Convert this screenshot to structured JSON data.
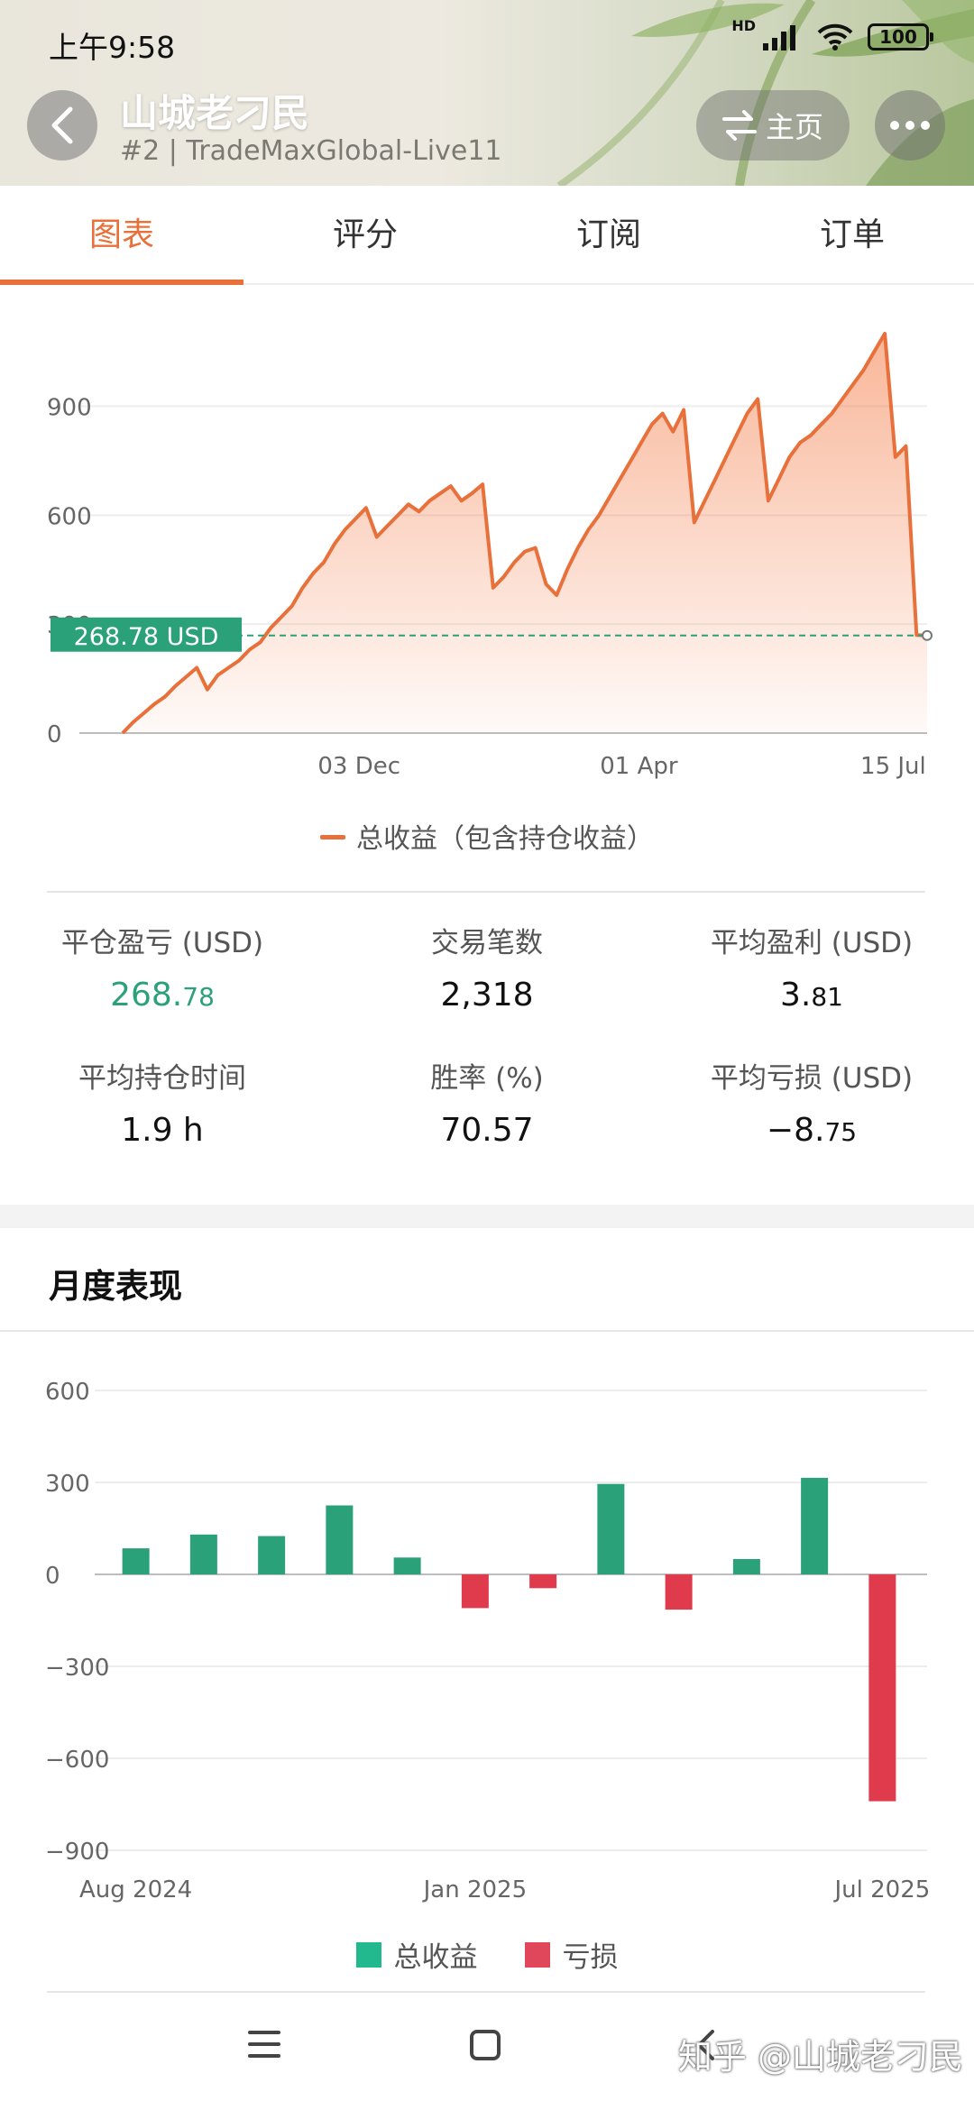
{
  "status": {
    "time": "上午9:58",
    "hd": "HD",
    "battery": "100"
  },
  "header": {
    "title": "山城老刁民",
    "subtitle": "#2 | TradeMaxGlobal-Live11",
    "home_label": "主页"
  },
  "tabs": [
    {
      "label": "图表",
      "active": true
    },
    {
      "label": "评分",
      "active": false
    },
    {
      "label": "订阅",
      "active": false
    },
    {
      "label": "订单",
      "active": false
    }
  ],
  "chart_data": [
    {
      "type": "area",
      "y_ticks": [
        "0",
        "300",
        "600",
        "900"
      ],
      "ylim": [
        0,
        1100
      ],
      "x_tick_labels": [
        "03 Dec",
        "01 Apr",
        "15 Jul"
      ],
      "x_tick_positions": [
        0.33,
        0.66,
        0.96
      ],
      "series": [
        {
          "name": "总收益（包含持仓收益）",
          "color": "#e8703a",
          "values": [
            0,
            30,
            55,
            80,
            100,
            130,
            155,
            180,
            120,
            160,
            180,
            200,
            230,
            250,
            290,
            320,
            350,
            400,
            440,
            470,
            520,
            560,
            590,
            620,
            540,
            570,
            600,
            630,
            610,
            640,
            660,
            680,
            640,
            660,
            685,
            400,
            430,
            470,
            500,
            510,
            410,
            380,
            450,
            510,
            560,
            600,
            650,
            700,
            750,
            800,
            850,
            880,
            830,
            890,
            580,
            640,
            700,
            760,
            820,
            880,
            920,
            640,
            700,
            760,
            800,
            820,
            850,
            880,
            920,
            960,
            1000,
            1050,
            1100,
            760,
            790,
            270,
            268.78
          ]
        }
      ],
      "reference_line": {
        "value": 268.78,
        "label": "268.78 USD",
        "color": "#2ba179"
      },
      "grid": true
    },
    {
      "type": "bar",
      "y_ticks": [
        "600",
        "300",
        "0",
        "−300",
        "−600",
        "−900"
      ],
      "ylim": [
        -900,
        600
      ],
      "x_tick_labels": [
        "Aug 2024",
        "Jan 2025",
        "Jul 2025"
      ],
      "x_tick_indices": [
        0,
        5,
        11
      ],
      "categories": [
        "Aug 2024",
        "Sep 2024",
        "Oct 2024",
        "Nov 2024",
        "Dec 2024",
        "Jan 2025",
        "Feb 2025",
        "Mar 2025",
        "Apr 2025",
        "May 2025",
        "Jun 2025",
        "Jul 2025"
      ],
      "values": [
        85,
        130,
        125,
        225,
        55,
        -110,
        -45,
        295,
        -115,
        50,
        315,
        -740
      ],
      "series_names": [
        "总收益",
        "亏损"
      ],
      "positive_color": "#2ba179",
      "negative_color": "#e03a4d",
      "grid": true
    }
  ],
  "legend_main": "总收益（包含持仓收益）",
  "stats": [
    {
      "label": "平仓盈亏 (USD)",
      "value_main": "268.",
      "value_small": "78",
      "color": "#2ba179"
    },
    {
      "label": "交易笔数",
      "value_main": "2,318",
      "value_small": ""
    },
    {
      "label": "平均盈利 (USD)",
      "value_main": "3.",
      "value_small": "81"
    },
    {
      "label": "平均持仓时间",
      "value_main": "1.9 h",
      "value_small": ""
    },
    {
      "label": "胜率 (%)",
      "value_main": "70.57",
      "value_small": ""
    },
    {
      "label": "平均亏损 (USD)",
      "value_main": "−8.",
      "value_small": "75"
    }
  ],
  "monthly": {
    "title": "月度表现",
    "legend": [
      {
        "label": "总收益",
        "color": "#21b98d"
      },
      {
        "label": "亏损",
        "color": "#e0475a"
      }
    ]
  },
  "watermark": "知乎 @山城老刁民"
}
